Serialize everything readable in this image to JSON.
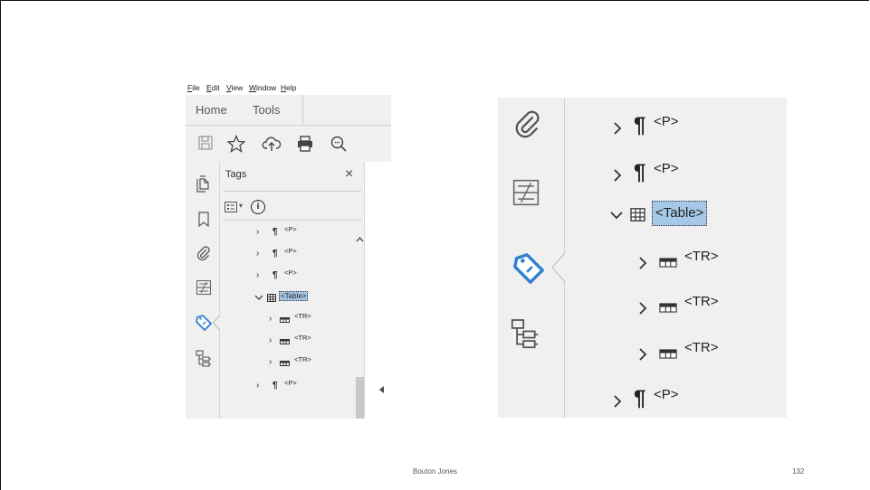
{
  "menu": {
    "items": [
      "File",
      "Edit",
      "View",
      "Window",
      "Help"
    ]
  },
  "tabs": {
    "home": "Home",
    "tools": "Tools"
  },
  "panel": {
    "title": "Tags",
    "close": "×",
    "options_arrow": "▾",
    "info": "i"
  },
  "tree_left": [
    {
      "label": "<P>",
      "type": "paragraph",
      "chevron": "›"
    },
    {
      "label": "<P>",
      "type": "paragraph",
      "chevron": "›"
    },
    {
      "label": "<P>",
      "type": "paragraph",
      "chevron": "›"
    },
    {
      "label": "<Table>",
      "type": "table",
      "chevron": "⌄",
      "selected": true
    },
    {
      "label": "<TR>",
      "type": "row",
      "chevron": "›"
    },
    {
      "label": "<TR>",
      "type": "row",
      "chevron": "›"
    },
    {
      "label": "<TR>",
      "type": "row",
      "chevron": "›"
    },
    {
      "label": "<P>",
      "type": "paragraph",
      "chevron": "›"
    }
  ],
  "tree_right": [
    {
      "label": "<P>",
      "type": "paragraph",
      "chevron": "›"
    },
    {
      "label": "<P>",
      "type": "paragraph",
      "chevron": "›"
    },
    {
      "label": "<Table>",
      "type": "table",
      "chevron": "⌄",
      "selected": true
    },
    {
      "label": "<TR>",
      "type": "row",
      "chevron": "›"
    },
    {
      "label": "<TR>",
      "type": "row",
      "chevron": "›"
    },
    {
      "label": "<TR>",
      "type": "row",
      "chevron": "›"
    },
    {
      "label": "<P>",
      "type": "paragraph",
      "chevron": "›"
    }
  ],
  "icons": {
    "rail": [
      "copy-pages-icon",
      "bookmark-icon",
      "attachment-icon",
      "compare-icon",
      "tag-icon",
      "content-tree-icon"
    ],
    "toolbar": [
      "save-icon",
      "star-icon",
      "cloud-upload-icon",
      "print-icon",
      "zoom-icon"
    ]
  },
  "footer": {
    "author": "Bouton Jones",
    "page": "132"
  },
  "colors": {
    "selection": "#a6c8e8",
    "tag_icon": "#2e7fd0",
    "panel_bg": "#f0f0f0"
  }
}
